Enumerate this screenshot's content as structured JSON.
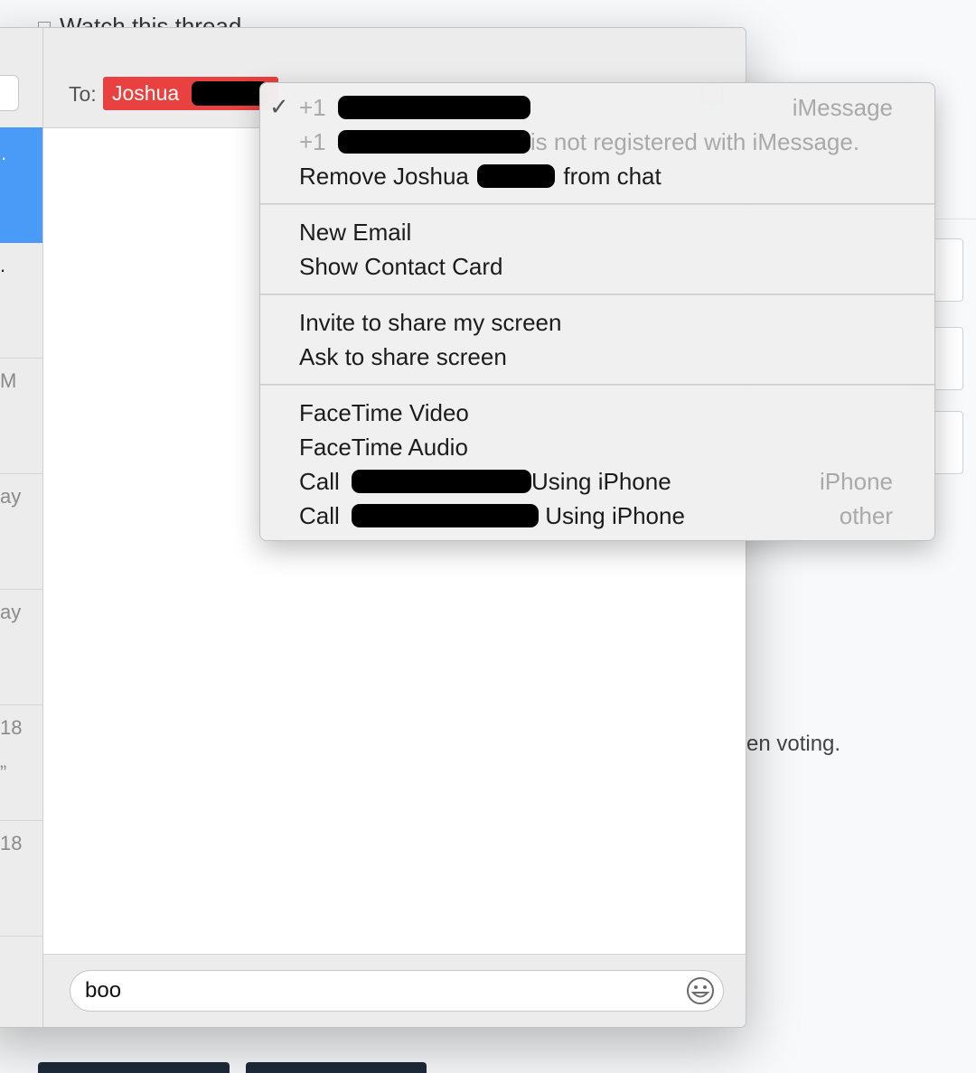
{
  "background": {
    "top_text": "Watch this thread",
    "voting_text": "en voting."
  },
  "window": {
    "sidebar": {
      "rows": [
        "",
        ".",
        "M",
        "ay",
        "ay",
        "18",
        "18"
      ],
      "quote_char": "”"
    },
    "header": {
      "to_label": "To:",
      "recipient_name": "Joshua"
    },
    "compose": {
      "text": "boo",
      "emoji_icon": "smiley-icon"
    }
  },
  "menu": {
    "group1": {
      "item1_prefix": "+1",
      "item1_right": "iMessage",
      "item2_prefix": "+1",
      "item2_suffix": "is not registered with iMessage.",
      "remove_prefix": "Remove Joshua",
      "remove_suffix": "from chat"
    },
    "group2": {
      "new_email": "New Email",
      "show_contact": "Show Contact Card"
    },
    "group3": {
      "invite_share": "Invite to share my screen",
      "ask_share": "Ask to share screen"
    },
    "group4": {
      "facetime_video": "FaceTime Video",
      "facetime_audio": "FaceTime Audio",
      "call1_prefix": "Call",
      "call1_suffix": "Using iPhone",
      "call1_right": "iPhone",
      "call2_prefix": "Call",
      "call2_suffix": "Using iPhone",
      "call2_right": "other"
    }
  }
}
